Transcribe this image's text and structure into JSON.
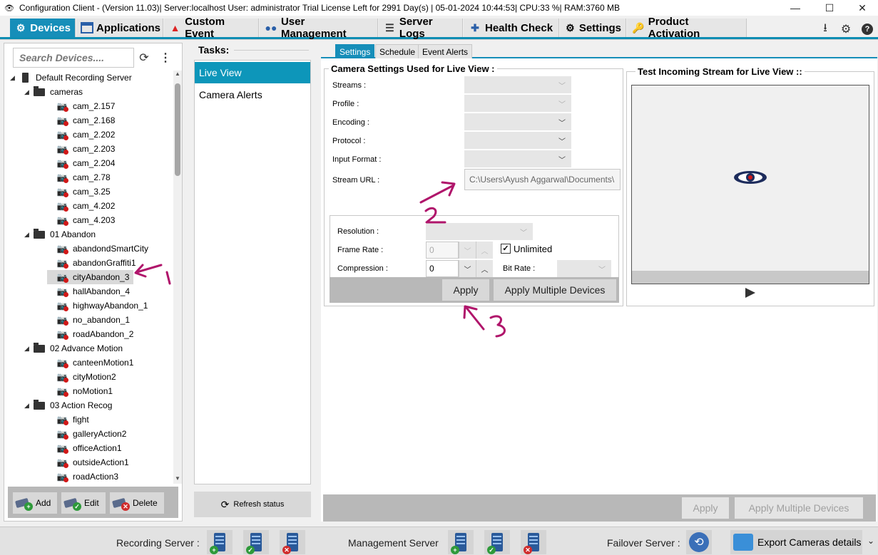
{
  "window": {
    "title": "Configuration Client - (Version 11.03)| Server:localhost  User: administrator Trial License Left for 2991 Day(s) | 05-01-2024 10:44:53| CPU:33 %| RAM:3760 MB"
  },
  "menu": {
    "tabs": [
      {
        "label": "Devices",
        "icon": "gear-icon"
      },
      {
        "label": "Applications",
        "icon": "window-icon"
      },
      {
        "label": "Custom Event",
        "icon": "warning-icon"
      },
      {
        "label": "User Management",
        "icon": "users-icon"
      },
      {
        "label": "Server Logs",
        "icon": "server-icon"
      },
      {
        "label": "Health Check",
        "icon": "health-icon"
      },
      {
        "label": "Settings",
        "icon": "gear-icon"
      },
      {
        "label": "Product Activation",
        "icon": "key-icon"
      }
    ]
  },
  "devices": {
    "search_placeholder": "Search Devices....",
    "tree": [
      {
        "label": "Default Recording Server",
        "type": "server",
        "level": 0,
        "toggle": "◢"
      },
      {
        "label": "cameras",
        "type": "folder",
        "level": 1,
        "toggle": "◢"
      },
      {
        "label": "cam_2.157",
        "type": "camera",
        "level": 2
      },
      {
        "label": "cam_2.168",
        "type": "camera",
        "level": 2
      },
      {
        "label": "cam_2.202",
        "type": "camera",
        "level": 2
      },
      {
        "label": "cam_2.203",
        "type": "camera",
        "level": 2
      },
      {
        "label": "cam_2.204",
        "type": "camera",
        "level": 2
      },
      {
        "label": "cam_2.78",
        "type": "camera",
        "level": 2
      },
      {
        "label": "cam_3.25",
        "type": "camera",
        "level": 2
      },
      {
        "label": "cam_4.202",
        "type": "camera",
        "level": 2
      },
      {
        "label": "cam_4.203",
        "type": "camera",
        "level": 2
      },
      {
        "label": "01 Abandon",
        "type": "folder",
        "level": 1,
        "toggle": "◢"
      },
      {
        "label": "abandondSmartCity",
        "type": "camera",
        "level": 2
      },
      {
        "label": "abandonGraffiti1",
        "type": "camera",
        "level": 2
      },
      {
        "label": "cityAbandon_3",
        "type": "camera",
        "level": 2,
        "selected": true
      },
      {
        "label": "hallAbandon_4",
        "type": "camera",
        "level": 2
      },
      {
        "label": "highwayAbandon_1",
        "type": "camera",
        "level": 2
      },
      {
        "label": "no_abandon_1",
        "type": "camera",
        "level": 2
      },
      {
        "label": "roadAbandon_2",
        "type": "camera",
        "level": 2
      },
      {
        "label": "02 Advance Motion",
        "type": "folder",
        "level": 1,
        "toggle": "◢"
      },
      {
        "label": "canteenMotion1",
        "type": "camera",
        "level": 2
      },
      {
        "label": "cityMotion2",
        "type": "camera",
        "level": 2
      },
      {
        "label": "noMotion1",
        "type": "camera",
        "level": 2
      },
      {
        "label": "03 Action Recog",
        "type": "folder",
        "level": 1,
        "toggle": "◢"
      },
      {
        "label": "fight",
        "type": "camera",
        "level": 2
      },
      {
        "label": "galleryAction2",
        "type": "camera",
        "level": 2
      },
      {
        "label": "officeAction1",
        "type": "camera",
        "level": 2
      },
      {
        "label": "outsideAction1",
        "type": "camera",
        "level": 2
      },
      {
        "label": "roadAction3",
        "type": "camera",
        "level": 2
      }
    ],
    "buttons": {
      "add": "Add",
      "edit": "Edit",
      "delete": "Delete"
    }
  },
  "tasks": {
    "title": "Tasks:",
    "items": [
      "Live View",
      "Camera Alerts"
    ],
    "refresh": "Refresh status"
  },
  "main": {
    "subtabs": [
      "Settings",
      "Schedule",
      "Event Alerts"
    ],
    "camera_settings": {
      "title": "Camera Settings Used for Live View :",
      "streams_label": "Streams :",
      "profile_label": "Profile :",
      "encoding_label": "Encoding :",
      "protocol_label": "Protocol :",
      "input_format_label": "Input Format :",
      "stream_url_label": "Stream URL :",
      "stream_url_value": "C:\\Users\\Ayush Aggarwal\\Documents\\",
      "resolution_label": "Resolution :",
      "frame_rate_label": "Frame Rate :",
      "frame_rate_value": "0",
      "unlimited_label": "Unlimited",
      "unlimited_checked": "✓",
      "compression_label": "Compression :",
      "compression_value": "0",
      "bit_rate_label": "Bit Rate :",
      "apply": "Apply",
      "apply_multiple": "Apply Multiple Devices"
    },
    "test_stream": {
      "title": "Test Incoming Stream for Live View ::"
    },
    "bottom_apply": "Apply",
    "bottom_apply_multiple": "Apply Multiple Devices"
  },
  "status": {
    "recording_server": "Recording Server :",
    "management_server": "Management Server",
    "failover_server": "Failover Server :",
    "export": "Export Cameras details"
  },
  "colors": {
    "accent": "#168eb9",
    "task_active": "#0d96ba",
    "annotation": "#b0156b",
    "alarm_red": "#d01818"
  }
}
